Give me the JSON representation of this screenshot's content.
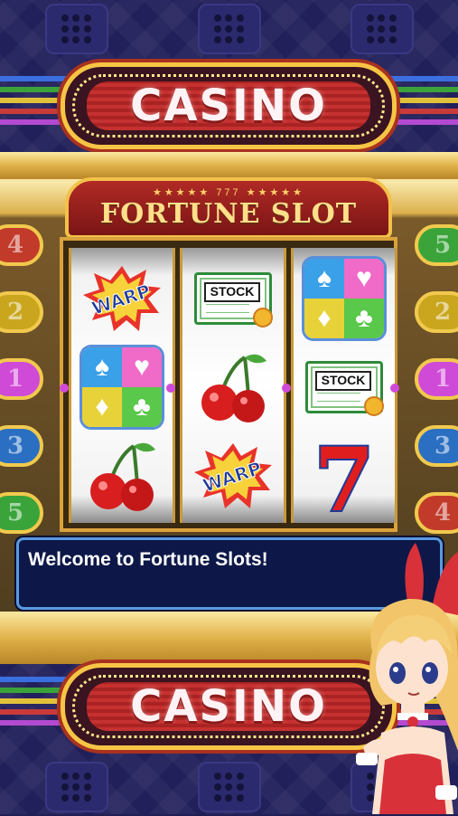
{
  "top_sign": {
    "text": "CASINO"
  },
  "machine": {
    "title_stars": "★★★★★ 777 ★★★★★",
    "title": "FORTUNE SLOT"
  },
  "side_lamps": {
    "left": [
      "4",
      "2",
      "1",
      "3",
      "5"
    ],
    "right": [
      "5",
      "2",
      "1",
      "3",
      "4"
    ]
  },
  "reels": [
    {
      "symbols": [
        "WARP",
        "suits",
        "cherry"
      ]
    },
    {
      "symbols": [
        "STOCK",
        "cherry",
        "WARP"
      ]
    },
    {
      "symbols": [
        "suits",
        "STOCK",
        "7"
      ]
    }
  ],
  "symbol_labels": {
    "warp": "WARP",
    "stock": "STOCK",
    "seven": "7"
  },
  "dialog": {
    "message": "Welcome to Fortune Slots!"
  },
  "bottom_sign": {
    "text": "CASINO"
  },
  "colors": {
    "lamp_4": "#c23a2a",
    "lamp_2": "#c9a61d",
    "lamp_1": "#d04ad8",
    "lamp_3": "#2a6fc2",
    "lamp_5": "#3aa43a"
  }
}
